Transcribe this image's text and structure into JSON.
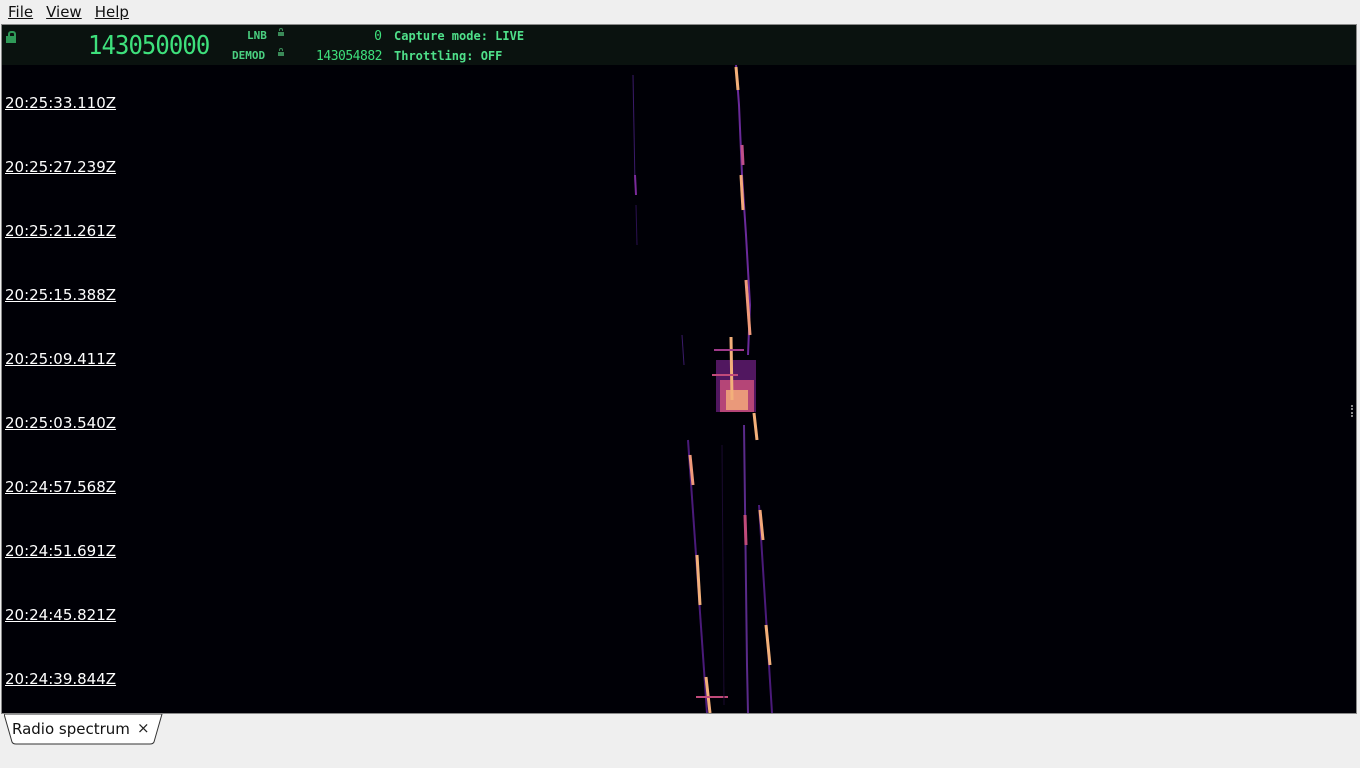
{
  "menu": {
    "items": [
      {
        "label": "File"
      },
      {
        "label": "View"
      },
      {
        "label": "Help"
      }
    ]
  },
  "header": {
    "lnb_freq": "143050000",
    "lnb_label": "LNB",
    "lnb_value": "0",
    "demod_label": "DEMOD",
    "demod_value": "143054882",
    "capture_mode": "Capture mode: LIVE",
    "throttling": "Throttling: OFF",
    "accent_color": "#3ee07c"
  },
  "waterfall": {
    "timestamps": [
      "20:25:33.110Z",
      "20:25:27.239Z",
      "20:25:21.261Z",
      "20:25:15.388Z",
      "20:25:09.411Z",
      "20:25:03.540Z",
      "20:24:57.568Z",
      "20:24:51.691Z",
      "20:24:45.821Z",
      "20:24:39.844Z"
    ]
  },
  "tabs": [
    {
      "label": "Radio spectrum",
      "close": "×"
    }
  ]
}
